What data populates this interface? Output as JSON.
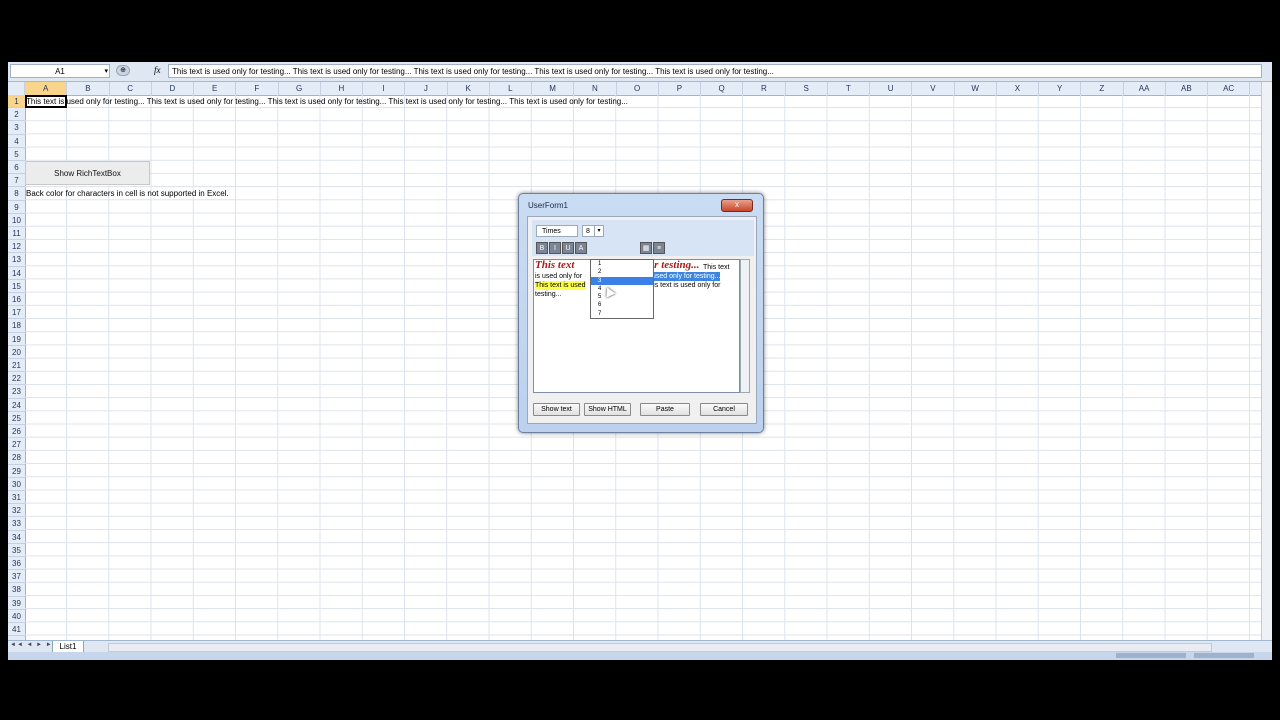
{
  "formula_bar": {
    "name_box": "A1",
    "fx": "fx",
    "content": "This text is used only for testing... This text is used only for testing... This text is used only for testing... This text is used only for testing... This text is used only for testing..."
  },
  "columns": [
    "A",
    "B",
    "C",
    "D",
    "E",
    "F",
    "G",
    "H",
    "I",
    "J",
    "K",
    "L",
    "M",
    "N",
    "O",
    "P",
    "Q",
    "R",
    "S",
    "T",
    "U",
    "V",
    "W",
    "X",
    "Y",
    "Z",
    "AA",
    "AB",
    "AC"
  ],
  "rows": [
    "1",
    "2",
    "3",
    "4",
    "5",
    "6",
    "7",
    "8",
    "9",
    "10",
    "11",
    "12",
    "13",
    "14",
    "15",
    "16",
    "17",
    "18",
    "19",
    "20",
    "21",
    "22",
    "23",
    "24",
    "25",
    "26",
    "27",
    "28",
    "29",
    "30",
    "31",
    "32",
    "33",
    "34",
    "35",
    "36",
    "37",
    "38",
    "39",
    "40",
    "41"
  ],
  "cells": {
    "a1": "This text is used only for testing... This text is used only for testing... This text is used only for testing... This text is used only for testing... This text is used only for testing...",
    "a8": "Back color for characters in cell is not supported in Excel."
  },
  "sheet_button": "Show RichTextBox",
  "sheet_tab": "List1",
  "dialog": {
    "title": "UserForm1",
    "close": "x",
    "font": "Times",
    "size": "8",
    "size_options": [
      "1",
      "2",
      "3",
      "4",
      "5",
      "6",
      "7"
    ],
    "selected_size_index": 2,
    "rich_text": {
      "line1_red_a": "This text",
      "line1_red_b": "for testing...",
      "line1_tail": "This text",
      "line2_a": "is used only for",
      "line2_blue": "is used only for testing...",
      "line3_yellow": "This text is used",
      "line3_tail": "This text is used only for",
      "line4": "testing..."
    },
    "buttons": {
      "show_text": "Show text",
      "show_html": "Show HTML",
      "paste": "Paste",
      "cancel": "Cancel"
    }
  },
  "colors": {
    "selected_header": "#f8d58b",
    "highlight_yellow": "#ffff4a",
    "highlight_blue": "#3d86e0",
    "red_text": "#b01818"
  }
}
